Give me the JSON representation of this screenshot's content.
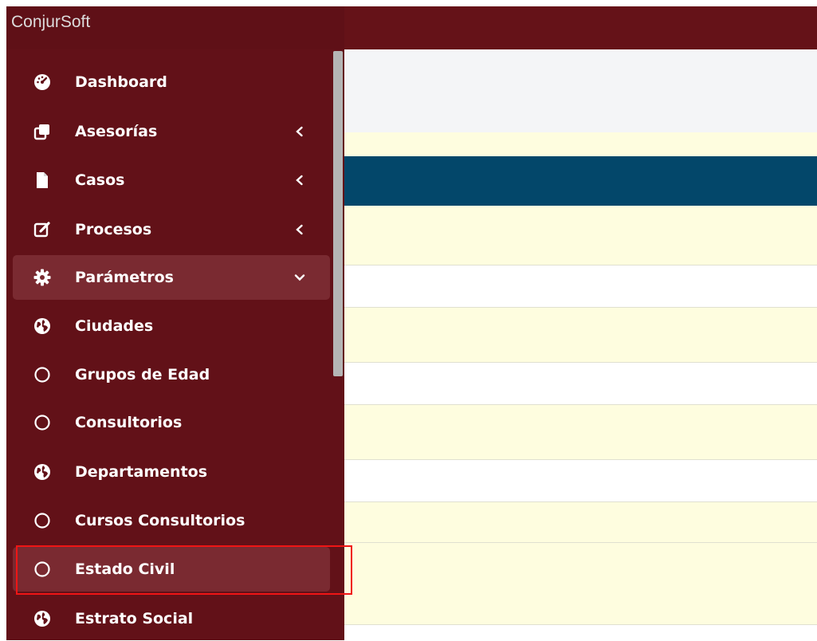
{
  "app": {
    "brand": "ConjurSoft"
  },
  "colors": {
    "header": "#651218",
    "sidebar": "#621118",
    "active_item": "#7a2a31",
    "table_header": "#03476a",
    "row_alt": "#fefddf",
    "row_plain": "#ffffff",
    "toolbar_gray": "#f4f5f7",
    "selection_box": "#f01515"
  },
  "sidebar": {
    "items": [
      {
        "label": "Dashboard",
        "icon": "dashboard-icon",
        "chevron": ""
      },
      {
        "label": "Asesorías",
        "icon": "copy-icon",
        "chevron": "chevron-left-icon"
      },
      {
        "label": "Casos",
        "icon": "file-icon",
        "chevron": "chevron-left-icon"
      },
      {
        "label": "Procesos",
        "icon": "edit-icon",
        "chevron": "chevron-left-icon"
      },
      {
        "label": "Parámetros",
        "icon": "gear-icon",
        "chevron": "chevron-down-icon"
      },
      {
        "label": "Ciudades",
        "icon": "globe-icon",
        "chevron": ""
      },
      {
        "label": "Grupos de Edad",
        "icon": "circle-icon",
        "chevron": ""
      },
      {
        "label": "Consultorios",
        "icon": "circle-icon",
        "chevron": ""
      },
      {
        "label": "Departamentos",
        "icon": "globe-icon",
        "chevron": ""
      },
      {
        "label": "Cursos Consultorios",
        "icon": "circle-icon",
        "chevron": ""
      },
      {
        "label": "Estado Civil",
        "icon": "circle-icon",
        "chevron": ""
      },
      {
        "label": "Estrato Social",
        "icon": "globe-icon",
        "chevron": ""
      }
    ]
  }
}
